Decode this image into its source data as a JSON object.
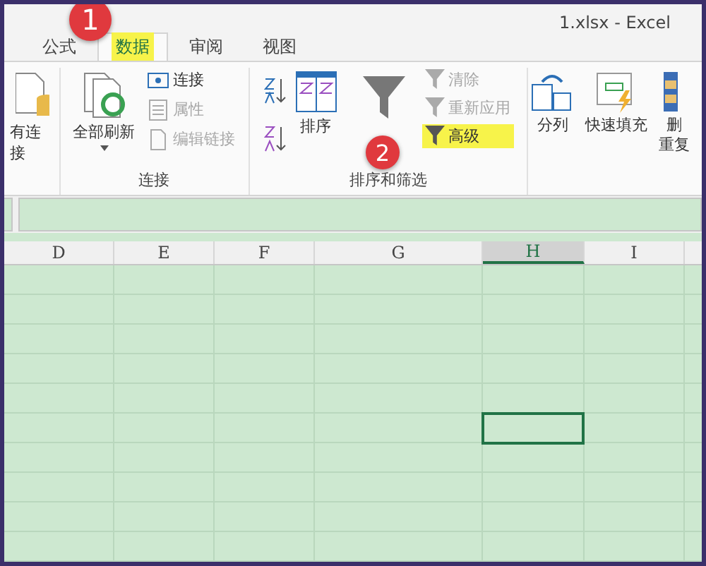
{
  "window": {
    "title": "1.xlsx - Excel"
  },
  "tabs": [
    {
      "label": "公式",
      "selected": false,
      "highlighted": false
    },
    {
      "label": "数据",
      "selected": true,
      "highlighted": true
    },
    {
      "label": "审阅",
      "selected": false,
      "highlighted": false
    },
    {
      "label": "视图",
      "selected": false,
      "highlighted": false
    }
  ],
  "ribbon": {
    "cut_button": {
      "label": "有连接"
    },
    "connections": {
      "label": "连接",
      "refresh": {
        "label": "全部刷新"
      },
      "items": [
        {
          "label": "连接",
          "disabled": false
        },
        {
          "label": "属性",
          "disabled": true
        },
        {
          "label": "编辑链接",
          "disabled": true
        }
      ]
    },
    "sort_filter": {
      "label": "排序和筛选",
      "sort": {
        "label": "排序"
      },
      "items": [
        {
          "label": "清除",
          "disabled": true,
          "highlighted": false
        },
        {
          "label": "重新应用",
          "disabled": true,
          "highlighted": false
        },
        {
          "label": "高级",
          "disabled": false,
          "highlighted": true
        }
      ]
    },
    "tools": [
      {
        "lines": [
          "分列"
        ]
      },
      {
        "lines": [
          "快速填充"
        ]
      },
      {
        "lines": [
          "删",
          "重复"
        ]
      }
    ]
  },
  "sheet": {
    "columns": [
      {
        "label": "D",
        "selected": false
      },
      {
        "label": "E",
        "selected": false
      },
      {
        "label": "F",
        "selected": false
      },
      {
        "label": "G",
        "selected": false
      },
      {
        "label": "H",
        "selected": true
      },
      {
        "label": "I",
        "selected": false
      }
    ]
  },
  "annotations": [
    {
      "label": "1"
    },
    {
      "label": "2"
    }
  ]
}
